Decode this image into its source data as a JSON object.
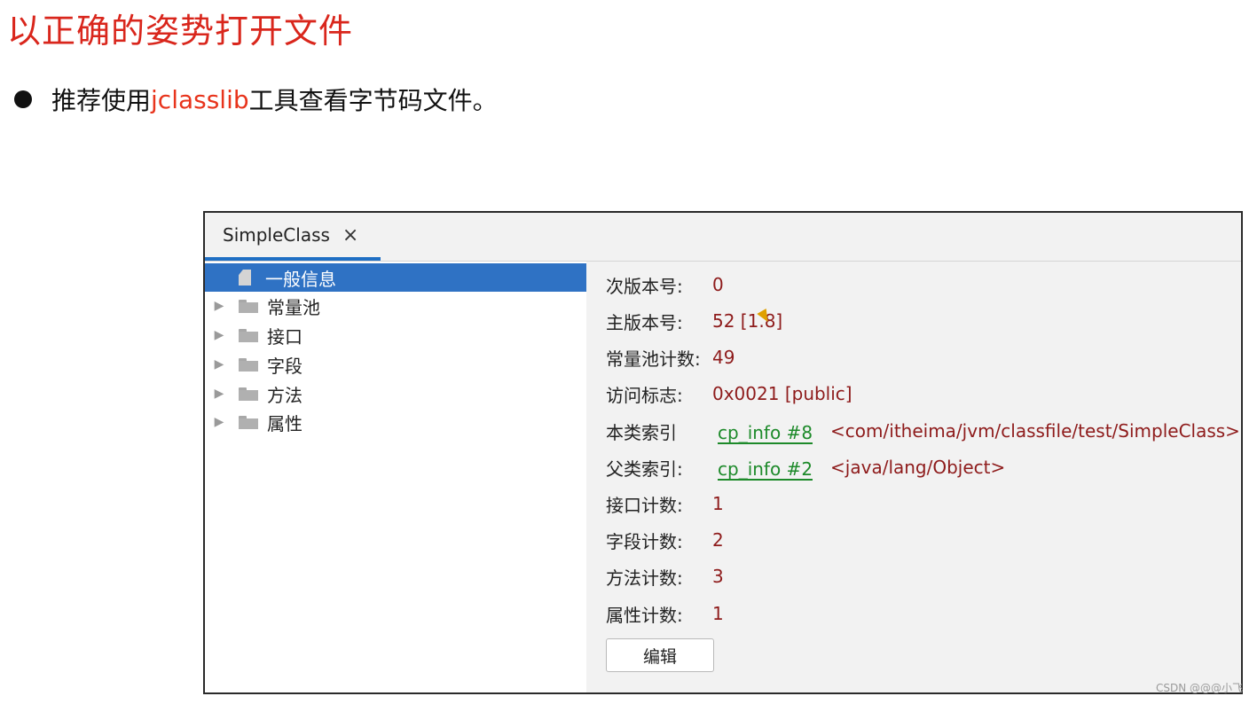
{
  "slide": {
    "title": "以正确的姿势打开文件",
    "bullet_prefix": "推荐使用 ",
    "bullet_highlight": "jclasslib",
    "bullet_suffix": "工具查看字节码文件。"
  },
  "window": {
    "tab_label": "SimpleClass",
    "tab_close": "×",
    "tree": [
      {
        "label": "一般信息",
        "icon": "file-icon",
        "selected": true
      },
      {
        "label": "常量池",
        "icon": "folder-icon"
      },
      {
        "label": "接口",
        "icon": "folder-icon"
      },
      {
        "label": "字段",
        "icon": "folder-icon"
      },
      {
        "label": "方法",
        "icon": "folder-icon"
      },
      {
        "label": "属性",
        "icon": "folder-icon"
      }
    ],
    "details": {
      "minor_version": {
        "label": "次版本号:",
        "value": "0"
      },
      "major_version": {
        "label": "主版本号:",
        "value": "52 [1.8]"
      },
      "constant_pool_count": {
        "label": "常量池计数:",
        "value": "49"
      },
      "access_flags": {
        "label": "访问标志:",
        "value": "0x0021 [public]"
      },
      "this_class": {
        "label": "本类索引",
        "link": "cp_info #8",
        "value": "<com/itheima/jvm/classfile/test/SimpleClass>"
      },
      "super_class": {
        "label": "父类索引:",
        "link": "cp_info #2",
        "value": "<java/lang/Object>"
      },
      "interfaces_count": {
        "label": "接口计数:",
        "value": "1"
      },
      "fields_count": {
        "label": "字段计数:",
        "value": "2"
      },
      "methods_count": {
        "label": "方法计数:",
        "value": "3"
      },
      "attributes_count": {
        "label": "属性计数:",
        "value": "1"
      }
    },
    "edit_button": "编辑"
  },
  "watermark": "CSDN @@@小飞",
  "colors": {
    "title_red": "#d9261c",
    "selection_blue": "#2f72c4",
    "value_red": "#8e1b1b",
    "link_green": "#1d8a2a"
  }
}
